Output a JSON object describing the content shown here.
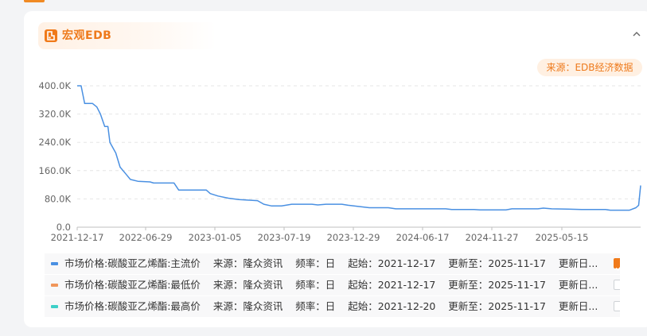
{
  "panel": {
    "title": "宏观EDB",
    "source_badge": "来源：EDB经济数据"
  },
  "chart_data": {
    "type": "line",
    "title": "",
    "xlabel": "",
    "ylabel": "",
    "ylim": [
      0,
      400000
    ],
    "y_ticks": [
      "400.0K",
      "320.0K",
      "240.0K",
      "160.0K",
      "80.0K",
      "0.0"
    ],
    "x_ticks": [
      "2021-12-17",
      "2022-06-29",
      "2023-01-05",
      "2023-07-19",
      "2023-12-29",
      "2024-06-17",
      "2024-11-27",
      "2025-05-15"
    ],
    "grid": true,
    "series": [
      {
        "name": "市场价格:碳酸亚乙烯酯:主流价",
        "color": "#4a90e2",
        "points": [
          [
            "2021-12-17",
            400000
          ],
          [
            "2021-12-27",
            400000
          ],
          [
            "2022-01-05",
            350000
          ],
          [
            "2022-01-25",
            350000
          ],
          [
            "2022-02-05",
            340000
          ],
          [
            "2022-02-14",
            320000
          ],
          [
            "2022-02-25",
            285000
          ],
          [
            "2022-03-05",
            285000
          ],
          [
            "2022-03-10",
            240000
          ],
          [
            "2022-03-25",
            210000
          ],
          [
            "2022-04-05",
            170000
          ],
          [
            "2022-04-20",
            150000
          ],
          [
            "2022-05-01",
            135000
          ],
          [
            "2022-05-20",
            130000
          ],
          [
            "2022-06-20",
            128000
          ],
          [
            "2022-06-29",
            125000
          ],
          [
            "2022-08-20",
            125000
          ],
          [
            "2022-09-01",
            105000
          ],
          [
            "2022-11-10",
            105000
          ],
          [
            "2022-11-20",
            95000
          ],
          [
            "2022-12-10",
            88000
          ],
          [
            "2023-01-05",
            82000
          ],
          [
            "2023-02-01",
            78000
          ],
          [
            "2023-03-20",
            75000
          ],
          [
            "2023-04-05",
            65000
          ],
          [
            "2023-04-25",
            60000
          ],
          [
            "2023-05-20",
            60000
          ],
          [
            "2023-06-15",
            65000
          ],
          [
            "2023-08-05",
            65000
          ],
          [
            "2023-08-20",
            63000
          ],
          [
            "2023-09-10",
            65000
          ],
          [
            "2023-10-20",
            65000
          ],
          [
            "2023-11-05",
            62000
          ],
          [
            "2023-12-29",
            55000
          ],
          [
            "2024-02-15",
            55000
          ],
          [
            "2024-03-05",
            52000
          ],
          [
            "2024-07-10",
            52000
          ],
          [
            "2024-07-25",
            50000
          ],
          [
            "2024-09-20",
            50000
          ],
          [
            "2024-10-05",
            49000
          ],
          [
            "2024-12-10",
            49000
          ],
          [
            "2024-12-25",
            52000
          ],
          [
            "2025-03-01",
            52000
          ],
          [
            "2025-03-15",
            54000
          ],
          [
            "2025-04-05",
            52000
          ],
          [
            "2025-05-15",
            51000
          ],
          [
            "2025-06-20",
            50000
          ],
          [
            "2025-08-20",
            50000
          ],
          [
            "2025-09-01",
            48000
          ],
          [
            "2025-10-20",
            48000
          ],
          [
            "2025-11-05",
            55000
          ],
          [
            "2025-11-12",
            62000
          ],
          [
            "2025-11-17",
            118000
          ]
        ]
      }
    ]
  },
  "legend": [
    {
      "label": "市场价格:碳酸亚乙烯酯:主流价",
      "color": "#4a90e2",
      "source_label": "来源：",
      "source": "隆众资讯",
      "freq_label": "频率：",
      "freq": "日",
      "start_label": "起始：",
      "start": "2021-12-17",
      "update_label": "更新至：",
      "update": "2025-11-17",
      "update_date_label": "更新日...",
      "checked": true
    },
    {
      "label": "市场价格:碳酸亚乙烯酯:最低价",
      "color": "#f0965a",
      "source_label": "来源：",
      "source": "隆众资讯",
      "freq_label": "频率：",
      "freq": "日",
      "start_label": "起始：",
      "start": "2021-12-17",
      "update_label": "更新至：",
      "update": "2025-11-17",
      "update_date_label": "更新日...",
      "checked": false
    },
    {
      "label": "市场价格:碳酸亚乙烯酯:最高价",
      "color": "#3ed0c8",
      "source_label": "来源：",
      "source": "隆众资讯",
      "freq_label": "频率：",
      "freq": "日",
      "start_label": "起始：",
      "start": "2021-12-20",
      "update_label": "更新至：",
      "update": "2025-11-17",
      "update_date_label": "更新日...",
      "checked": false
    }
  ]
}
